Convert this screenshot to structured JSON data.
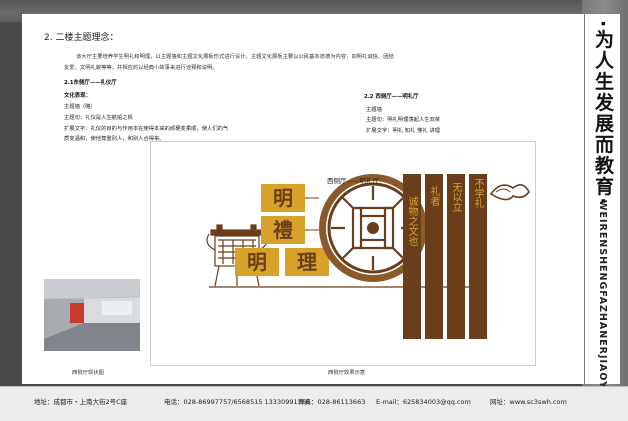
{
  "side_title": {
    "cn": "·为人生发展而教育·",
    "en": "WEIRENSHENGFAZHANERJIAOYU"
  },
  "section": {
    "heading": "2. 二楼主题理念：",
    "intro_line1": "该大厅主要培养学生明礼和明理，以主题墙和主题文化展板形式进行设计。主题文化展板主要以公民基本道德为内容，如明礼诚信、团结",
    "intro_line2": "友爱、文明礼貌等等，并相应的以经典小故事来进行诠释和说明。"
  },
  "east_hall": {
    "title": "2.1东侧厅——礼仪厅",
    "culture_label": "文化表现：",
    "wall_label": "主题墙（略）",
    "theme_sentence": "主题句：礼仪是人生航船之帆",
    "expand_line1": "扩展文字：礼仪的目的与作用本在使得本来的顽梗变柔顺，使人们的气",
    "expand_line2": "质变温和，使他尊重别人，和别人合得来。"
  },
  "west_hall": {
    "title": "2.2 西侧厅——明礼厅",
    "wall_label": "主题墙",
    "theme_sentence": "主题句：明礼明理荡起人生双桨",
    "expand_text": "扩展文字：明礼 知礼 懂礼 讲理"
  },
  "render": {
    "label": "西侧厅——明礼厅",
    "chars_left": [
      "明",
      "禮",
      "明",
      "理"
    ],
    "panel_texts": [
      "不学礼",
      "无以立",
      "礼者",
      "诚物之文也"
    ],
    "caption": "西侧厅效果示意"
  },
  "photo": {
    "caption": "西侧厅现状图"
  },
  "footer": {
    "address": "地址：成都市・上南大街2号C座",
    "phone": "电话：028-86997757/6568515  13330991366",
    "fax": "传真：028-86113663",
    "email": "E-mail：625834003@qq.com",
    "website": "网址：www.sc3swh.com"
  },
  "colors": {
    "brown": "#6b3e1b",
    "gold": "#d8a12a",
    "backdrop": "#4a4a4a"
  }
}
